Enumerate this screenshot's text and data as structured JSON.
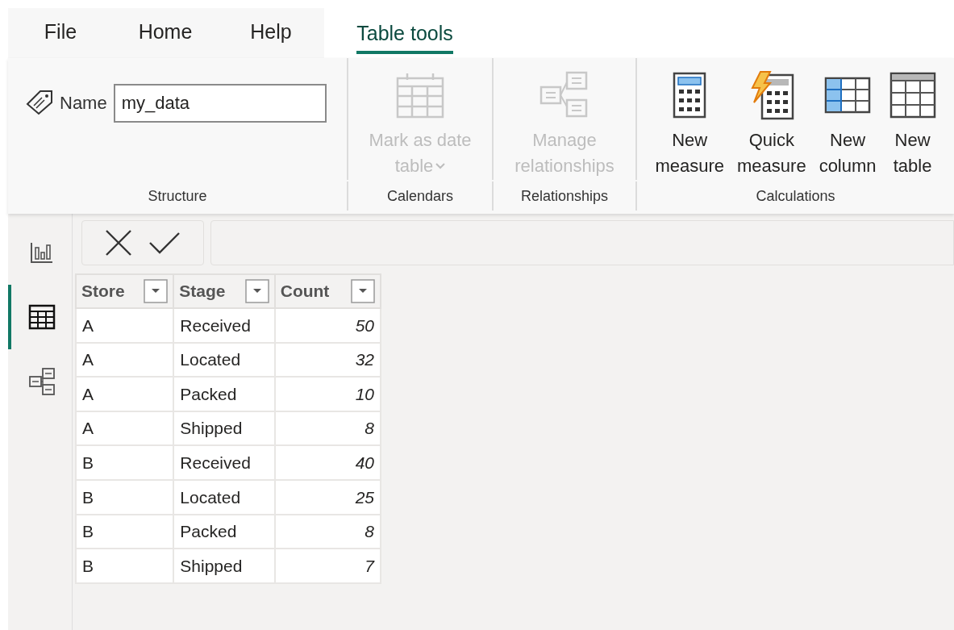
{
  "tabs": [
    {
      "label": "File",
      "selected": false
    },
    {
      "label": "Home",
      "selected": false
    },
    {
      "label": "Help",
      "selected": false
    },
    {
      "label": "Table tools",
      "selected": true
    }
  ],
  "ribbon": {
    "groups": [
      {
        "label": "Structure",
        "name_field": {
          "label": "Name",
          "value": "my_data"
        }
      },
      {
        "label": "Calendars",
        "buttons": [
          {
            "kind": "calendar",
            "lines": [
              "Mark as date",
              "table"
            ],
            "disabled": true,
            "dropdown": true
          }
        ]
      },
      {
        "label": "Relationships",
        "buttons": [
          {
            "kind": "relationships",
            "lines": [
              "Manage",
              "relationships"
            ],
            "disabled": true,
            "dropdown": false
          }
        ]
      },
      {
        "label": "Calculations",
        "buttons": [
          {
            "kind": "measure",
            "lines": [
              "New",
              "measure"
            ],
            "disabled": false,
            "dropdown": false
          },
          {
            "kind": "quick-measure",
            "lines": [
              "Quick",
              "measure"
            ],
            "disabled": false,
            "dropdown": false
          },
          {
            "kind": "column",
            "lines": [
              "New",
              "column"
            ],
            "disabled": false,
            "dropdown": false
          },
          {
            "kind": "table",
            "lines": [
              "New",
              "table"
            ],
            "disabled": false,
            "dropdown": false
          }
        ]
      }
    ]
  },
  "sidebar": {
    "items": [
      {
        "kind": "report",
        "selected": false
      },
      {
        "kind": "data",
        "selected": true
      },
      {
        "kind": "model",
        "selected": false
      }
    ]
  },
  "table": {
    "columns": [
      {
        "name": "Store",
        "kind": "text"
      },
      {
        "name": "Stage",
        "kind": "text"
      },
      {
        "name": "Count",
        "kind": "number"
      }
    ],
    "rows": [
      [
        "A",
        "Received",
        "50"
      ],
      [
        "A",
        "Located",
        "32"
      ],
      [
        "A",
        "Packed",
        "10"
      ],
      [
        "A",
        "Shipped",
        "8"
      ],
      [
        "B",
        "Received",
        "40"
      ],
      [
        "B",
        "Located",
        "25"
      ],
      [
        "B",
        "Packed",
        "8"
      ],
      [
        "B",
        "Shipped",
        "7"
      ]
    ]
  }
}
